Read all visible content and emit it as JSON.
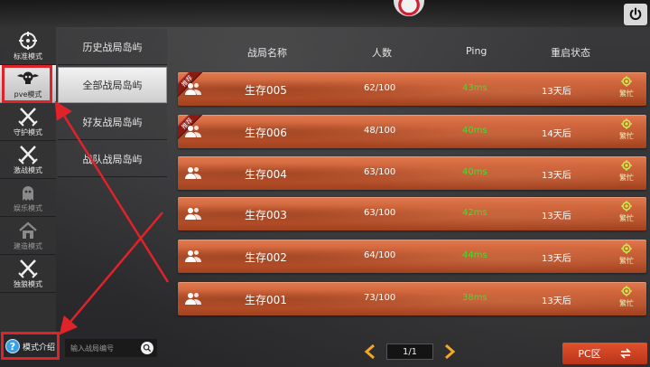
{
  "modes": [
    {
      "key": "standard",
      "label": "标准模式",
      "icon": "crosshair-icon"
    },
    {
      "key": "pve",
      "label": "pve模式",
      "icon": "skull-wings-icon",
      "active": true
    },
    {
      "key": "guard",
      "label": "守护模式",
      "icon": "crossed-swords-icon"
    },
    {
      "key": "intense",
      "label": "激战模式",
      "icon": "crossed-swords-icon"
    },
    {
      "key": "fun",
      "label": "娱乐模式",
      "icon": "ghost-icon",
      "dim": true
    },
    {
      "key": "build",
      "label": "建造模式",
      "icon": "house-icon",
      "dim": true
    },
    {
      "key": "lone",
      "label": "独狼模式",
      "icon": "crossed-swords-icon"
    }
  ],
  "regions": [
    {
      "label": "历史战局岛屿"
    },
    {
      "label": "全部战局岛屿",
      "active": true
    },
    {
      "label": "好友战局岛屿"
    },
    {
      "label": "战队战局岛屿"
    }
  ],
  "help": {
    "label": "模式介绍",
    "icon": "question-circle-icon"
  },
  "search": {
    "placeholder": "输入战局编号",
    "value": ""
  },
  "table": {
    "headers": {
      "name": "战局名称",
      "players": "人数",
      "ping": "Ping",
      "restart": "重启状态"
    },
    "rows": [
      {
        "name": "生存005",
        "players": "62/100",
        "ping": "43ms",
        "restart": "13天后",
        "status": "繁忙",
        "tag": "推荐"
      },
      {
        "name": "生存006",
        "players": "48/100",
        "ping": "40ms",
        "restart": "14天后",
        "status": "繁忙",
        "tag": "推荐"
      },
      {
        "name": "生存004",
        "players": "63/100",
        "ping": "40ms",
        "restart": "13天后",
        "status": "繁忙",
        "tag": ""
      },
      {
        "name": "生存003",
        "players": "63/100",
        "ping": "42ms",
        "restart": "13天后",
        "status": "繁忙",
        "tag": ""
      },
      {
        "name": "生存002",
        "players": "64/100",
        "ping": "44ms",
        "restart": "13天后",
        "status": "繁忙",
        "tag": ""
      },
      {
        "name": "生存001",
        "players": "73/100",
        "ping": "38ms",
        "restart": "13天后",
        "status": "繁忙",
        "tag": ""
      }
    ]
  },
  "pager": {
    "label": "1/1"
  },
  "server_button": {
    "label": "PC区"
  },
  "colors": {
    "ping_green": "#3fe02a",
    "row_orange": "#c65a32",
    "highlight_red": "#e0222a",
    "pc_button": "#d2452a",
    "pager_arrow": "#f5a623"
  }
}
